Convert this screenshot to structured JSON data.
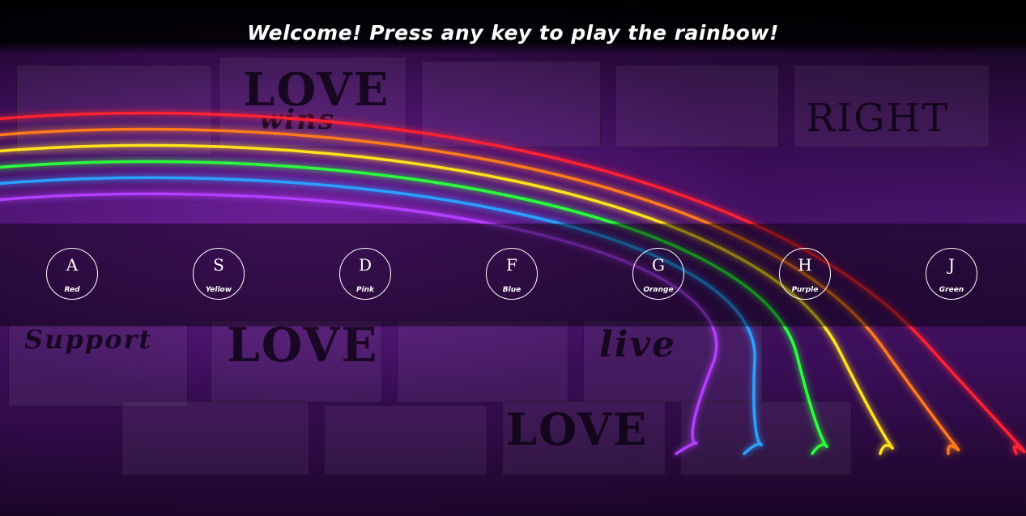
{
  "header": {
    "title": "Welcome! Press any key to play the rainbow!"
  },
  "keys": [
    {
      "letter": "A",
      "color_name": "Red"
    },
    {
      "letter": "S",
      "color_name": "Yellow"
    },
    {
      "letter": "D",
      "color_name": "Pink"
    },
    {
      "letter": "F",
      "color_name": "Blue"
    },
    {
      "letter": "G",
      "color_name": "Orange"
    },
    {
      "letter": "H",
      "color_name": "Purple"
    },
    {
      "letter": "J",
      "color_name": "Green"
    }
  ],
  "background_signs": [
    "LOVE",
    "wins",
    "RIGHT",
    "LOVE",
    "Support",
    "live",
    "LOVE"
  ],
  "colors": {
    "rainbow": [
      "#ff2233",
      "#ff7a1a",
      "#ffe21a",
      "#2cff3a",
      "#2aa0ff",
      "#b43cff"
    ],
    "key_border": "#ffffff",
    "text": "#ffffff"
  }
}
